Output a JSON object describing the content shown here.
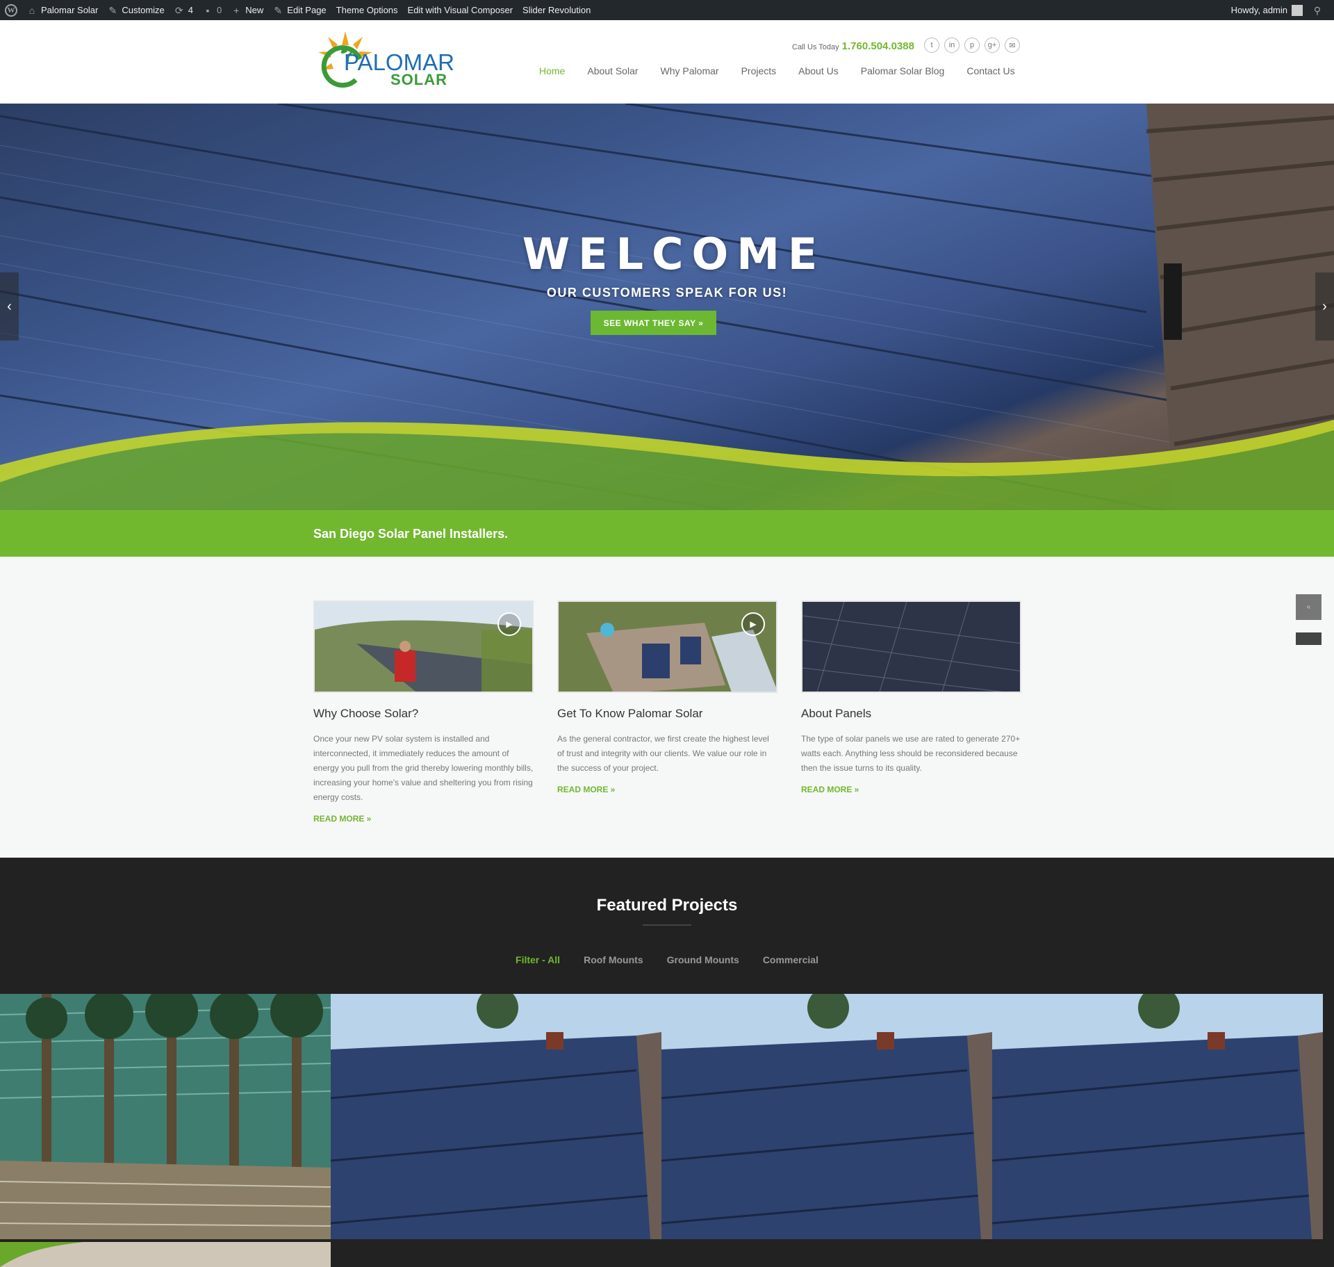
{
  "adminbar": {
    "site_name": "Palomar Solar",
    "customize": "Customize",
    "updates_count": "4",
    "comments_count": "0",
    "new_label": "New",
    "edit_page": "Edit Page",
    "theme_options": "Theme Options",
    "visual_composer": "Edit with Visual Composer",
    "slider_revolution": "Slider Revolution",
    "howdy": "Howdy, admin"
  },
  "header": {
    "logo_line1": "PALOMAR",
    "logo_line2": "SOLAR",
    "call_label": "Call Us Today",
    "phone": "1.760.504.0388",
    "nav": [
      "Home",
      "About Solar",
      "Why Palomar",
      "Projects",
      "About Us",
      "Palomar Solar Blog",
      "Contact Us"
    ]
  },
  "hero": {
    "title": "WELCOME",
    "subtitle": "OUR CUSTOMERS SPEAK FOR US!",
    "button": "SEE WHAT THEY SAY »"
  },
  "strip": {
    "text": "San Diego Solar Panel Installers."
  },
  "features": [
    {
      "title": "Why Choose Solar?",
      "body": "Once your new PV solar system is installed and interconnected, it immediately reduces the amount of energy you pull from the grid thereby lowering monthly bills, increasing your home's value and sheltering you from rising energy costs.",
      "more": "READ MORE »"
    },
    {
      "title": "Get To Know Palomar Solar",
      "body": "As the general contractor, we first create the highest level of trust and integrity with our clients. We value our role in the success of your project.",
      "more": "READ MORE »"
    },
    {
      "title": "About Panels",
      "body": "The type of solar panels we use are rated to generate 270+ watts each. Anything less should be reconsidered because then the issue turns to its quality.",
      "more": "READ MORE »"
    }
  ],
  "projects": {
    "title": "Featured Projects",
    "filters": [
      "Filter - All",
      "Roof Mounts",
      "Ground Mounts",
      "Commercial"
    ]
  },
  "colors": {
    "accent": "#72b82f",
    "dark": "#222222",
    "admin_bar": "#23282d"
  }
}
